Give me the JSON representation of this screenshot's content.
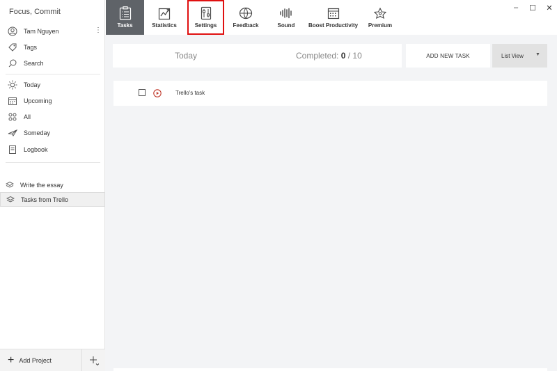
{
  "app": {
    "title": "Focus, Commit"
  },
  "sidebar": {
    "user": {
      "name": "Tam Nguyen",
      "more_label": "⋮"
    },
    "nav": [
      {
        "label": "Tags",
        "icon": "tag-icon"
      },
      {
        "label": "Search",
        "icon": "search-icon"
      }
    ],
    "filters": [
      {
        "label": "Today",
        "icon": "sun-icon"
      },
      {
        "label": "Upcoming",
        "icon": "calendar-icon"
      },
      {
        "label": "All",
        "icon": "all-icon"
      },
      {
        "label": "Someday",
        "icon": "plane-icon"
      },
      {
        "label": "Logbook",
        "icon": "logbook-icon"
      }
    ],
    "projects": [
      {
        "label": "Write the essay",
        "icon": "layers-icon",
        "selected": false
      },
      {
        "label": "Tasks from Trello",
        "icon": "layers-icon",
        "selected": true
      }
    ],
    "footer": {
      "add_project_label": "Add Project",
      "plus_symbol": "+"
    }
  },
  "toolbar": {
    "items": [
      {
        "label": "Tasks",
        "icon": "tasks-clipboard-icon",
        "active": true
      },
      {
        "label": "Statistics",
        "icon": "statistics-chart-icon"
      },
      {
        "label": "Settings",
        "icon": "settings-sliders-icon",
        "highlighted": true
      },
      {
        "label": "Feedback",
        "icon": "feedback-globe-icon"
      },
      {
        "label": "Sound",
        "icon": "sound-wave-icon"
      },
      {
        "label": "Boost Productivity",
        "icon": "boost-calendar-icon"
      },
      {
        "label": "Premium",
        "icon": "premium-crown-icon"
      }
    ],
    "window_controls": {
      "minimize": "–",
      "maximize": "☐",
      "close": "✕"
    }
  },
  "main": {
    "header": {
      "today_label": "Today",
      "completed_label": "Completed: ",
      "completed_count": "0",
      "completed_separator": " / ",
      "completed_total": "10"
    },
    "add_task_label": "ADD NEW TASK",
    "view_select": {
      "value": "List View",
      "caret": "▼"
    },
    "tasks": [
      {
        "name": "Trello's task",
        "checked": false
      }
    ]
  },
  "colors": {
    "accent_active_tab": "#5f6368",
    "highlight_outline": "#e01010",
    "play_icon": "#c0392b",
    "background": "#f3f4f6"
  }
}
